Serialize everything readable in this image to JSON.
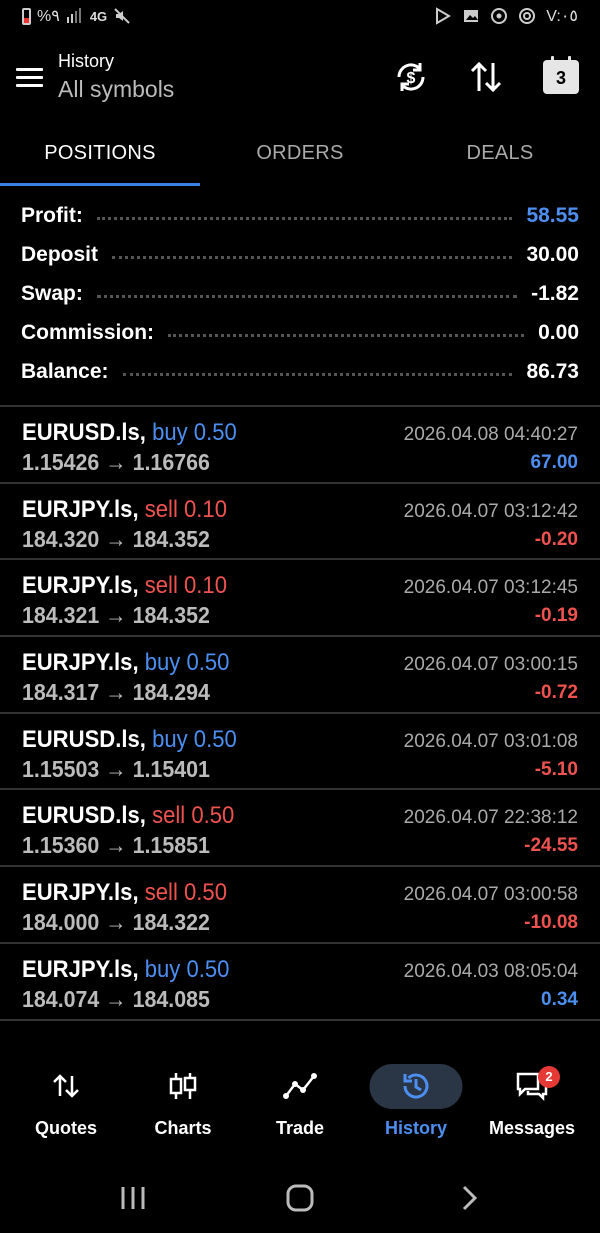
{
  "status_bar": {
    "left_text": "%٩",
    "network": "4G",
    "time": "V:٠٥"
  },
  "header": {
    "title": "History",
    "subtitle": "All symbols",
    "calendar_day": "3"
  },
  "tabs": [
    {
      "label": "POSITIONS",
      "active": true
    },
    {
      "label": "ORDERS",
      "active": false
    },
    {
      "label": "DEALS",
      "active": false
    }
  ],
  "summary": {
    "profit_label": "Profit:",
    "profit_value": "58.55",
    "deposit_label": "Deposit",
    "deposit_value": "30.00",
    "swap_label": "Swap:",
    "swap_value": "-1.82",
    "commission_label": "Commission:",
    "commission_value": "0.00",
    "balance_label": "Balance:",
    "balance_value": "86.73"
  },
  "positions": [
    {
      "symbol": "EURUSD.ls,",
      "side": "buy 0.50",
      "side_type": "buy",
      "prices": "1.15426 → 1.16766",
      "date": "2026.04.08 04:40:27",
      "profit": "67.00",
      "profit_sign": "pos"
    },
    {
      "symbol": "EURJPY.ls,",
      "side": "sell 0.10",
      "side_type": "sell",
      "prices": "184.320 → 184.352",
      "date": "2026.04.07 03:12:42",
      "profit": "-0.20",
      "profit_sign": "neg"
    },
    {
      "symbol": "EURJPY.ls,",
      "side": "sell 0.10",
      "side_type": "sell",
      "prices": "184.321 → 184.352",
      "date": "2026.04.07 03:12:45",
      "profit": "-0.19",
      "profit_sign": "neg"
    },
    {
      "symbol": "EURJPY.ls,",
      "side": "buy 0.50",
      "side_type": "buy",
      "prices": "184.317 → 184.294",
      "date": "2026.04.07 03:00:15",
      "profit": "-0.72",
      "profit_sign": "neg"
    },
    {
      "symbol": "EURUSD.ls,",
      "side": "buy 0.50",
      "side_type": "buy",
      "prices": "1.15503 → 1.15401",
      "date": "2026.04.07 03:01:08",
      "profit": "-5.10",
      "profit_sign": "neg"
    },
    {
      "symbol": "EURUSD.ls,",
      "side": "sell 0.50",
      "side_type": "sell",
      "prices": "1.15360 → 1.15851",
      "date": "2026.04.07 22:38:12",
      "profit": "-24.55",
      "profit_sign": "neg"
    },
    {
      "symbol": "EURJPY.ls,",
      "side": "sell 0.50",
      "side_type": "sell",
      "prices": "184.000 → 184.322",
      "date": "2026.04.07 03:00:58",
      "profit": "-10.08",
      "profit_sign": "neg"
    },
    {
      "symbol": "EURJPY.ls,",
      "side": "buy 0.50",
      "side_type": "buy",
      "prices": "184.074 → 184.085",
      "date": "2026.04.03 08:05:04",
      "profit": "0.34",
      "profit_sign": "pos"
    }
  ],
  "bottom_nav": [
    {
      "label": "Quotes",
      "icon": "quotes-arrows-icon"
    },
    {
      "label": "Charts",
      "icon": "candlestick-icon"
    },
    {
      "label": "Trade",
      "icon": "trend-line-icon"
    },
    {
      "label": "History",
      "icon": "history-clock-icon",
      "active": true
    },
    {
      "label": "Messages",
      "icon": "chat-icon",
      "badge": "2"
    }
  ],
  "colors": {
    "accent": "#4c8ff0",
    "sell": "#ef5350",
    "background": "#000000"
  }
}
